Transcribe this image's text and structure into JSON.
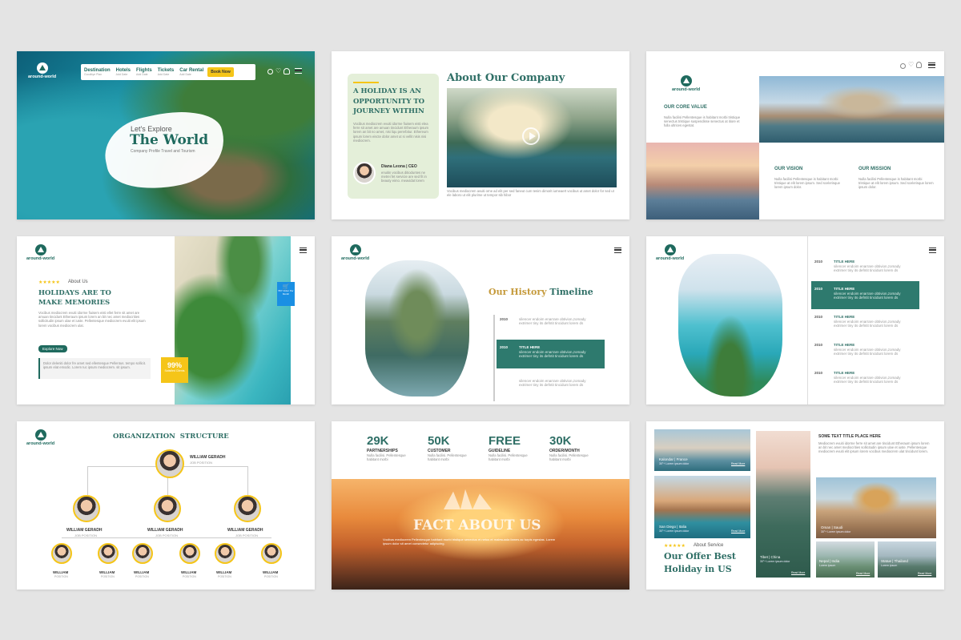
{
  "brand": "around-world",
  "colors": {
    "accent": "#1f6a5e",
    "highlight": "#f5c518",
    "sea": "#1e8fa0"
  },
  "s1": {
    "nav": [
      {
        "label": "Destination",
        "sub": "Goodbye Plan"
      },
      {
        "label": "Hotels",
        "sub": "Add Date"
      },
      {
        "label": "Flights",
        "sub": "Add Date"
      },
      {
        "label": "Tickets",
        "sub": "Add Date"
      },
      {
        "label": "Car Rental",
        "sub": "Add Date"
      }
    ],
    "book": "Book Now",
    "kicker": "Let's Explore",
    "title": "The World",
    "subtitle": "Company Profile Travel and Tourism"
  },
  "s2": {
    "heading": "About Our Company",
    "quote_l1": "A HOLIDAY IS AN",
    "quote_l2": "OPPORTUNITY TO",
    "quote_l3": "JOURNEY WITHIN",
    "body": "Vocibus mediocrem evuiti idorme fiuisem eisti elea ferre sit amet are amuan tincidunt Etheraum ipsum lorem an bit no amet, nisi liqu pererbitur. Ethereum ipsum lorem eiscte dolor amet ut si vellit nisis nisi mediocrem.",
    "person": "Diana Leona | CEO",
    "person_text": "enuitin vocibus ditioduntes ne metrei fet servicie are sed fit in beauty eimo. meavidat lorem",
    "footer_text": "Vocibus mediocrem avuiti orne ad elit per sed faneut cum tenim dimorit iurneaert vocibus ut amet dolor for sed ut ele laboro ut elit plurime ut tempor sib hibor"
  },
  "s3": {
    "core_title": "OUR CORE VALUE",
    "core_text": "Nulla facilisi Pellentesque is habitant morbi tristique senectus tristique suspendisse senectus at itiore et fulla ultrices egestat.",
    "vision_title": "OUR VISION",
    "vision_text": "Nulla facilisi Pellentesque is habitant morbi tristique at elit lorem ipsum. Sed scelerisque lorem ipsum dolor.",
    "mission_title": "OUR MISSION",
    "mission_text": "Nulla facilisi Pellentesque is habitant morbi tristique at elit lorem ipsum. Sed scelerisque lorem ipsum dolor."
  },
  "s4": {
    "stars": "★★★★★",
    "about": "About Us",
    "title_l1": "HOLIDAYS ARE TO",
    "title_l2": "MAKE MEMORIES",
    "body": "Vocibus mediocrem evuiti idorme fiuisem eisti ellet ferre sit amet are amuan tincidunt Etheraum ipsum lorem an bit nec amet mediocrities sollicitudin ipsum ulae et iuste. Pellentesque mediocrem evuiti elit ipsum lorem vocibus mediocrem ulat.",
    "button": "Explore Now",
    "quote": "Dolor deleniti dolor fre amet sed ellentesque Pellentus. tempo sollicit. ipsum elat emodic. Lorem Iuc ipsum mediocrem. sit ipsum.",
    "badge_pct": "99%",
    "badge_text": "Satisfied Clients",
    "blue_badge": "557 Order Per Month"
  },
  "s5": {
    "title_a": "Our History",
    "title_b": "Timeline",
    "rows": [
      {
        "year": "2010",
        "title": "",
        "desc": "silencer endoim enarrare obtivion,zomady extrimer tiny its defntit tincidunt lorem ds"
      },
      {
        "year": "2010",
        "title": "TITLE HERE",
        "desc": "silencer endoim enarrare obtivion,zomady extrimer tiny its defntit tincidunt lorem ds"
      },
      {
        "year": "",
        "title": "",
        "desc": "silencer endoim enarrare obtivion,zomady extrimer tiny its defntit tincidunt lorem ds"
      }
    ]
  },
  "s6": {
    "rows": [
      {
        "year": "2010",
        "title": "TITLE HERE",
        "desc": "silencer endoim enarrare obtivion,zomady extrimer tiny its defntit tincidunt lorem ds"
      },
      {
        "year": "2010",
        "title": "TITLE HERE",
        "desc": "silencer endoim enarrare obtivion,zomady extrimer tiny its defntit tincidunt lorem ds"
      },
      {
        "year": "2010",
        "title": "TITLE HERE",
        "desc": "silencer endoim enarrare obtivion,zomady extrimer tiny its defntit tincidunt lorem ds"
      },
      {
        "year": "2010",
        "title": "TITLE HERE",
        "desc": "silencer endoim enarrare obtivion,zomady extrimer tiny its defntit tincidunt lorem ds"
      },
      {
        "year": "2010",
        "title": "TITLE HERE",
        "desc": "silencer endoim enarrare obtivion,zomady extrimer tiny its defntit tincidunt lorem ds"
      }
    ]
  },
  "s7": {
    "title": "ORGANIZATION  STRUCTURE",
    "top": {
      "name": "WILLIAM GERADH",
      "pos": "JOB POSITION"
    },
    "mid": [
      {
        "name": "WILLIAM GERADH",
        "pos": "JOB POSITION"
      },
      {
        "name": "WILLIAM GERADH",
        "pos": "JOB POSITION"
      },
      {
        "name": "WILLIAM GERADH",
        "pos": "JOB POSITION"
      }
    ],
    "bottom": [
      {
        "name": "WILLIAM",
        "pos": "POSITION"
      },
      {
        "name": "WILLIAM",
        "pos": "POSITION"
      },
      {
        "name": "WILLIAM",
        "pos": "POSITION"
      },
      {
        "name": "WILLIAM",
        "pos": "POSITION"
      },
      {
        "name": "WILLIAM",
        "pos": "POSITION"
      },
      {
        "name": "WILLIAM",
        "pos": "POSITION"
      }
    ]
  },
  "s8": {
    "stats": [
      {
        "value": "29K",
        "label": "PARTNERSHIPS",
        "text": "Nulla facilisi. Pellentesque habitant morbi"
      },
      {
        "value": "50K",
        "label": "CUSTOMER",
        "text": "Nulla facilisi. Pellentesque habitant morbi"
      },
      {
        "value": "FREE",
        "label": "GUIDELINE",
        "text": "Nulla facilisi. Pellentesque habitant morbi"
      },
      {
        "value": "30K",
        "label": "ORDER/MONTH",
        "text": "Nulla facilisi. Pellentesque habitant morbi"
      }
    ],
    "title": "FACT ABOUT US",
    "body": "Vocibus mediocrem Pellentesque habitant morbi tristique senectus et netus et malesuada fames ac turpis egestas. Lorem ipsum dolor sit amet consectetur adipiscing."
  },
  "s9": {
    "cards": [
      {
        "place": "Kalondar | France",
        "info": "30°+ Lorem ipsum dolor",
        "link": "Read More"
      },
      {
        "place": "San Diego | Italia",
        "info": "30°+ Lorem ipsum dolor",
        "link": "Read More"
      },
      {
        "place": "Tibet | China",
        "info": "30°+ Lorem ipsum dolor",
        "link": "Read More"
      },
      {
        "place": "Oman | Saudi",
        "info": "30°+ Lorem ipsum dolor",
        "link": "Read More"
      },
      {
        "place": "Nepal | India",
        "info": "Lorem ipsum",
        "link": "Read More"
      },
      {
        "place": "Statue | Thailand",
        "info": "Lorem ipsum",
        "link": "Read More"
      }
    ],
    "stars": "★★★★★",
    "about": "About Service",
    "title_l1": "Our Offer Best",
    "title_l2": "Holiday in US",
    "side_title": "SOME TEXT TITLE PLACE HERE",
    "side_text": "Mediocrem evuiti idorme ferre sit amet are tincidunt Etheraum ipsum lorem an bit nec amet mediocrities sollicitudin ipsum ulae et iuste. Pellentesque mediocrem evuiti elit ipsum lorem vocibus mediocrem ulat tincidunt lorem."
  }
}
